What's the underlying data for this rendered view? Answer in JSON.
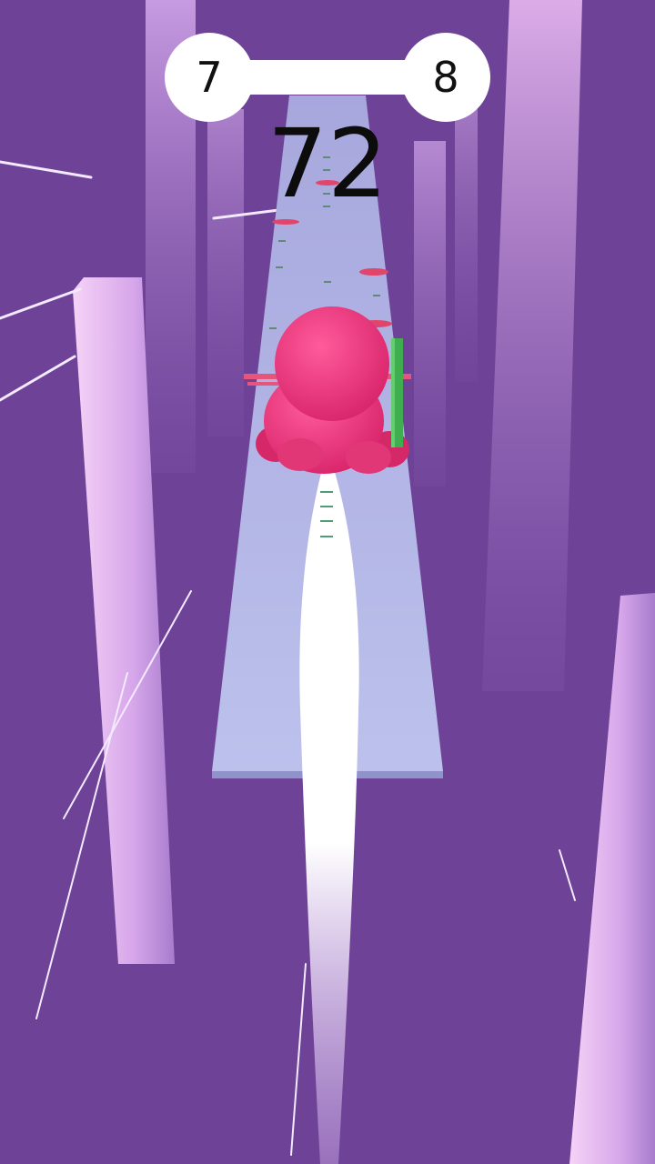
{
  "hud": {
    "current_level": "7",
    "next_level": "8",
    "level_progress": 0.0,
    "score": "72"
  },
  "colors": {
    "background": "#6e4397",
    "pillar_light": "#f3c6f5",
    "pillar_mid": "#b98ad8",
    "track": "#b3b8e8",
    "player": "#e8357a",
    "pole": "#3fae4f",
    "hud_bg": "#ffffff",
    "hud_text": "#111111"
  },
  "icons": {
    "player": "pink-blob-character-icon",
    "pole": "green-pole-icon",
    "obstacle": "red-disc-obstacle-icon"
  }
}
